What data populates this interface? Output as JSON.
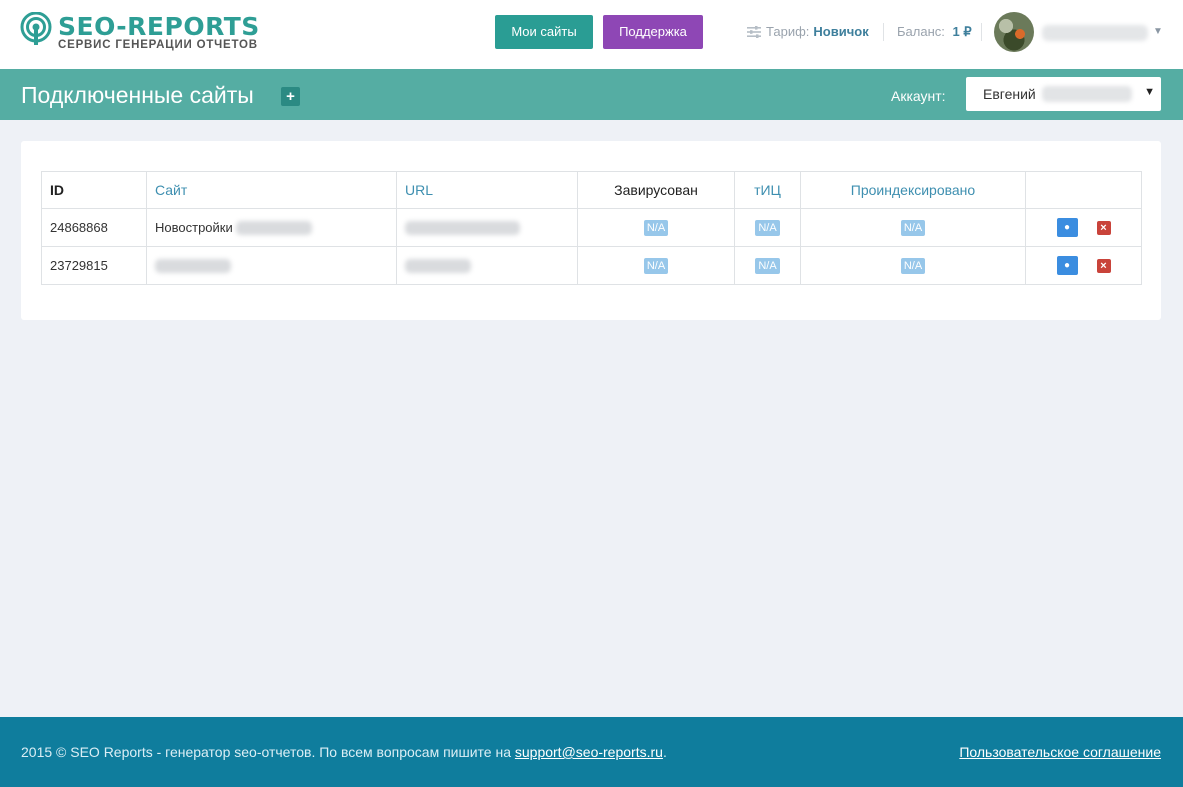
{
  "brand": {
    "name": "SEO-REPORTS",
    "tagline": "СЕРВИС ГЕНЕРАЦИИ ОТЧЕТОВ",
    "color": "#2e9e95"
  },
  "header": {
    "my_sites_label": "Мои сайты",
    "support_label": "Поддержка",
    "tariff_label": "Тариф:",
    "tariff_value": "Новичок",
    "balance_label": "Баланс:",
    "balance_value": "1 ₽"
  },
  "titlebar": {
    "title": "Подключенные сайты",
    "add_icon": "plus-icon",
    "account_label": "Аккаунт:",
    "account_value": "Евгений"
  },
  "table": {
    "headers": {
      "id": "ID",
      "site": "Сайт",
      "url": "URL",
      "infected": "Завирусован",
      "tic": "тИЦ",
      "indexed": "Проиндексировано"
    },
    "rows": [
      {
        "id": "24868868",
        "site": "Новостройки",
        "infected": "N/A",
        "tic": "N/A",
        "indexed": "N/A"
      },
      {
        "id": "23729815",
        "site": "",
        "infected": "N/A",
        "tic": "N/A",
        "indexed": "N/A"
      }
    ]
  },
  "footer": {
    "copyright": "2015 © SEO Reports - генератор seo-отчетов. По всем вопросам пишите на ",
    "email": "support@seo-reports.ru",
    "period": ".",
    "terms": "Пользовательское соглашение"
  },
  "colors": {
    "teal_bar": "#55ada3",
    "footer": "#0f7d9d",
    "support_button": "#8e47b5",
    "sites_button": "#2a9d94"
  }
}
